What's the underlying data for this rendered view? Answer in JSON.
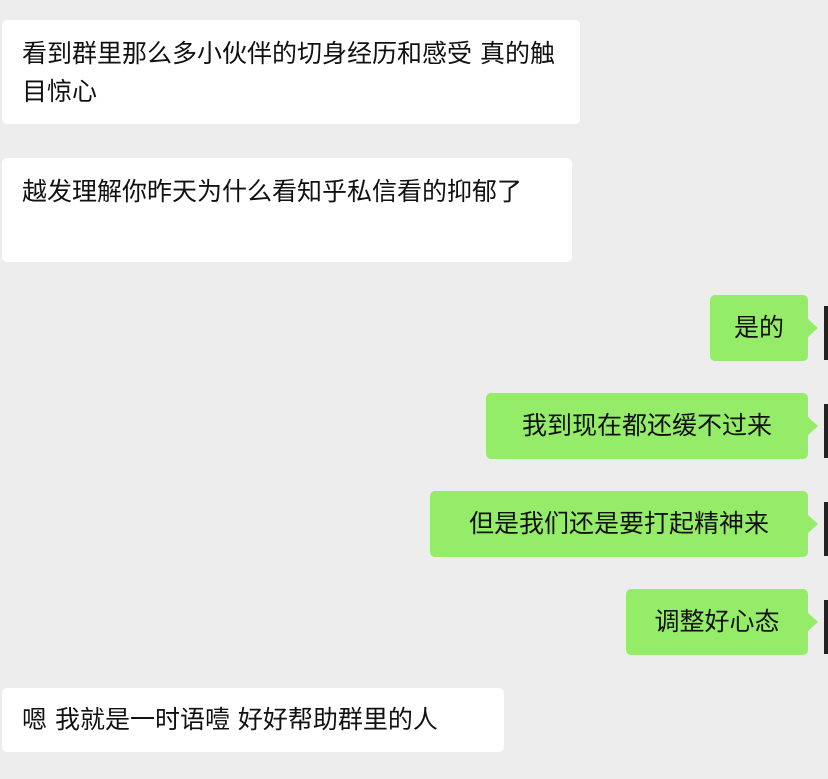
{
  "messages": [
    {
      "from": "other",
      "text": "看到群里那么多小伙伴的切身经历和感受 真的触目惊心"
    },
    {
      "from": "other",
      "text": "越发理解你昨天为什么看知乎私信看的抑郁了"
    },
    {
      "from": "self",
      "text": "是的"
    },
    {
      "from": "self",
      "text": "我到现在都还缓不过来"
    },
    {
      "from": "self",
      "text": "但是我们还是要打起精神来"
    },
    {
      "from": "self",
      "text": "调整好心态"
    },
    {
      "from": "other",
      "text": "嗯 我就是一时语噎 好好帮助群里的人"
    }
  ],
  "colors": {
    "background": "#ededed",
    "incoming_bubble": "#ffffff",
    "outgoing_bubble": "#95ec69",
    "text": "#111111"
  }
}
